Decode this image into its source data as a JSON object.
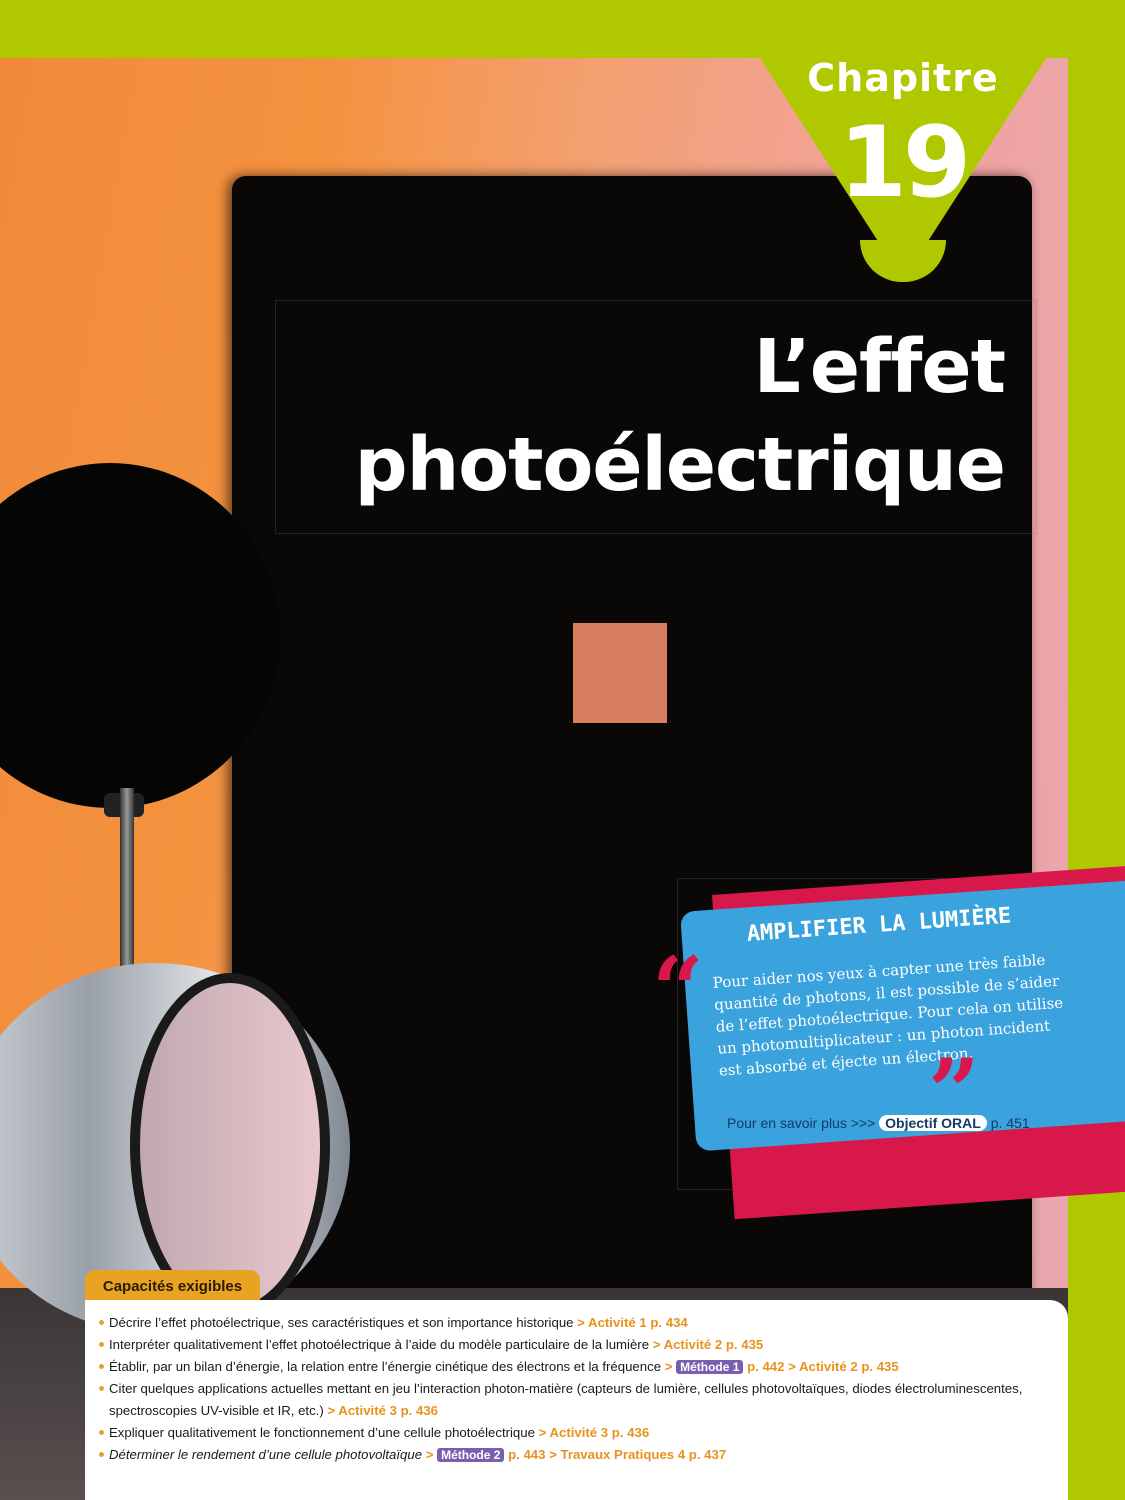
{
  "chapter": {
    "label": "Chapitre",
    "number": "19"
  },
  "title": {
    "line1": "L’effet",
    "line2": "photoélectrique"
  },
  "quote": {
    "heading": "AMPLIFIER LA LUMIÈRE",
    "text": "Pour aider nos yeux à capter une très faible quantité de photons, il est possible de s’aider de l’effet photoélectrique. Pour cela on utilise un photomultiplicateur : un photon incident est absorbé et éjecte un électron.",
    "more_prefix": "Pour en savoir plus >>>",
    "more_badge": "Objectif ORAL",
    "more_page": "p. 451",
    "open_mark": "“",
    "close_mark": "”"
  },
  "capacites": {
    "title": "Capacités exigibles",
    "items": [
      {
        "text": "Décrire l’effet photoélectrique, ses caractéristiques et son importance historique",
        "ref": "> Activité 1 p. 434"
      },
      {
        "text": "Interpréter qualitativement l’effet photoélectrique à l’aide du modèle particulaire de la lumière",
        "ref": "> Activité 2 p. 435"
      },
      {
        "text": "Établir, par un bilan d’énergie, la relation entre l’énergie cinétique des électrons et la fréquence",
        "sep": ">",
        "method": "Méthode 1",
        "ref": "p. 442 > Activité 2 p. 435"
      },
      {
        "text": "Citer quelques applications actuelles mettant en jeu l’interaction photon-matière (capteurs de lumière, cellules photovoltaïques, diodes électroluminescentes, spectroscopies UV-visible et IR, etc.)",
        "ref": "> Activité 3 p. 436"
      },
      {
        "text": "Expliquer qualitativement le fonctionnement d’une cellule photoélectrique",
        "ref": "> Activité 3 p. 436"
      },
      {
        "text": "Déterminer le rendement d’une cellule photovoltaïque",
        "sep": ">",
        "method": "Méthode 2",
        "ref": "p. 443 > Travaux Pratiques 4 p. 437"
      }
    ]
  },
  "colors": {
    "accent_green": "#b0c800",
    "quote_blue": "#3aa2dc",
    "quote_red": "#d8174a",
    "ref_orange": "#e8921e",
    "method_purple": "#7a5fb0"
  }
}
